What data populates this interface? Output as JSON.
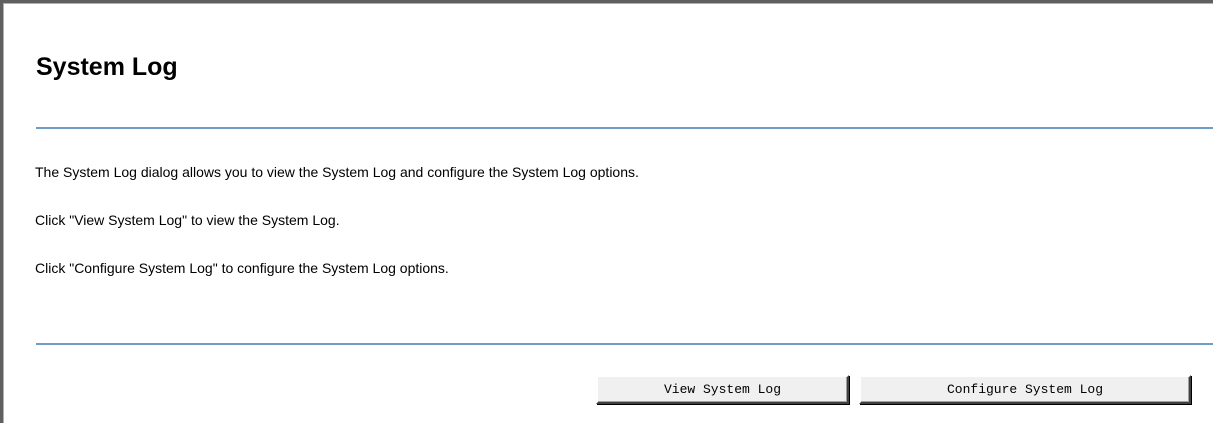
{
  "page": {
    "title": "System Log"
  },
  "description": {
    "line1": "The System Log dialog allows you to view the System Log and configure the System Log options.",
    "line2": "Click \"View System Log\" to view the System Log.",
    "line3": "Click \"Configure System Log\" to configure the System Log options."
  },
  "buttons": {
    "view_label": "View System Log",
    "configure_label": "Configure System Log"
  },
  "colors": {
    "rule": "#6e9cc4",
    "frame": "#606060",
    "button_face": "#f0f0f0"
  }
}
